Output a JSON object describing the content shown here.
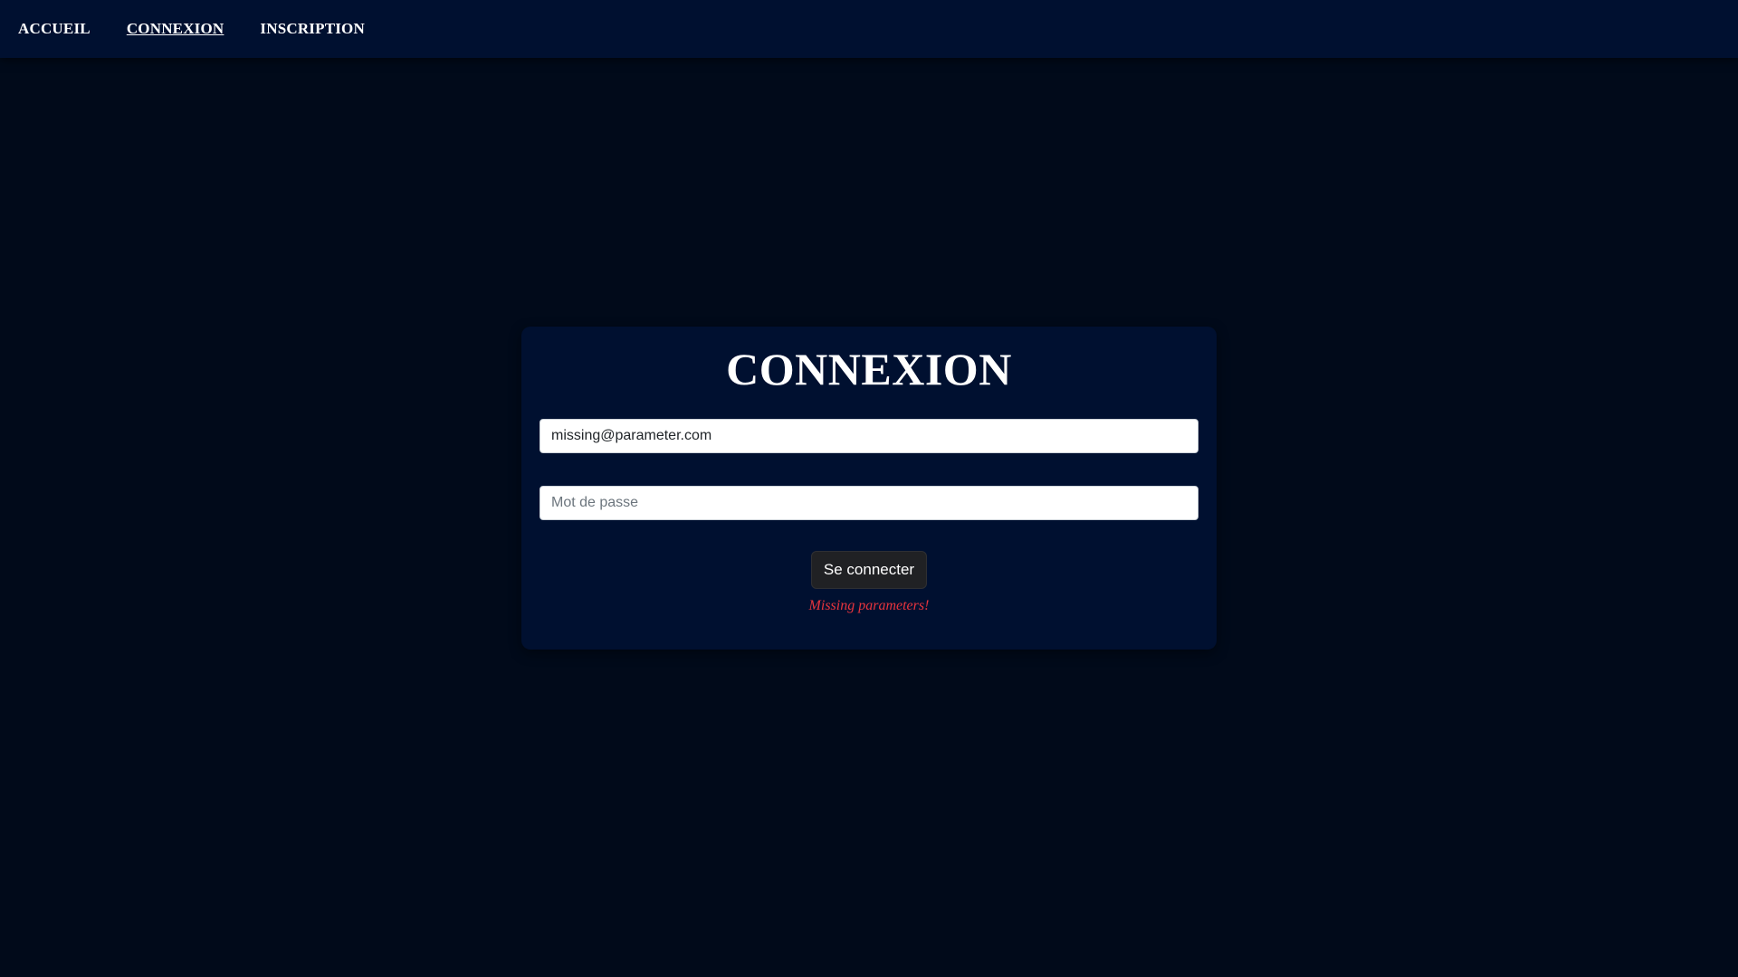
{
  "nav": {
    "items": [
      {
        "label": "ACCUEIL",
        "active": false
      },
      {
        "label": "CONNEXION",
        "active": true
      },
      {
        "label": "INSCRIPTION",
        "active": false
      }
    ]
  },
  "login": {
    "title": "CONNEXION",
    "email": {
      "value": "missing@parameter.com"
    },
    "password": {
      "placeholder": "Mot de passe",
      "value": ""
    },
    "submit_label": "Se connecter",
    "error_message": "Missing parameters!"
  },
  "colors": {
    "page_background": "#010a1a",
    "navbar_background": "#001030",
    "card_background": "#001030",
    "button_background": "#202124",
    "error_text": "#e8343d"
  }
}
